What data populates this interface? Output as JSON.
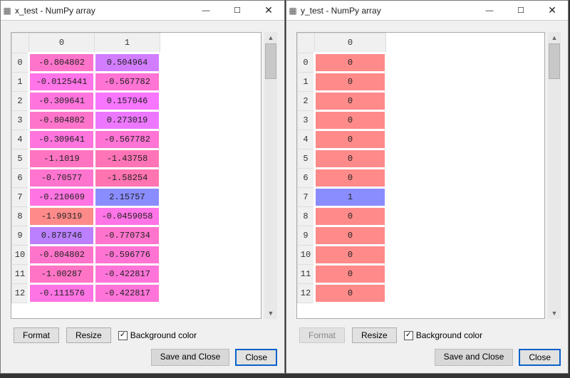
{
  "left": {
    "title": "x_test - NumPy array",
    "columns": [
      "0",
      "1"
    ],
    "rows": [
      {
        "idx": "0",
        "v": [
          "-0.804802",
          "0.504964"
        ],
        "c": [
          "#ff74cb",
          "#d27dff"
        ]
      },
      {
        "idx": "1",
        "v": [
          "-0.0125441",
          "-0.567782"
        ],
        "c": [
          "#ff74e8",
          "#ff74d4"
        ]
      },
      {
        "idx": "2",
        "v": [
          "-0.309641",
          "0.157046"
        ],
        "c": [
          "#ff74dd",
          "#f875ff"
        ]
      },
      {
        "idx": "3",
        "v": [
          "-0.804802",
          "0.273019"
        ],
        "c": [
          "#ff74cb",
          "#ed78ff"
        ]
      },
      {
        "idx": "4",
        "v": [
          "-0.309641",
          "-0.567782"
        ],
        "c": [
          "#ff74dd",
          "#ff74d4"
        ]
      },
      {
        "idx": "5",
        "v": [
          "-1.1019",
          "-1.43758"
        ],
        "c": [
          "#ff74c1",
          "#ff74b6"
        ]
      },
      {
        "idx": "6",
        "v": [
          "-0.70577",
          "-1.58254"
        ],
        "c": [
          "#ff74cf",
          "#ff74b1"
        ]
      },
      {
        "idx": "7",
        "v": [
          "-0.210609",
          "2.15757"
        ],
        "c": [
          "#ff74e1",
          "#8a8dff"
        ]
      },
      {
        "idx": "8",
        "v": [
          "-1.99319",
          "-0.0459058"
        ],
        "c": [
          "#ff8a8a",
          "#ff74e6"
        ]
      },
      {
        "idx": "9",
        "v": [
          "0.878746",
          "-0.770734"
        ],
        "c": [
          "#ba80ff",
          "#ff74cd"
        ]
      },
      {
        "idx": "10",
        "v": [
          "-0.804802",
          "-0.596776"
        ],
        "c": [
          "#ff74cb",
          "#ff74d3"
        ]
      },
      {
        "idx": "11",
        "v": [
          "-1.00287",
          "-0.422817"
        ],
        "c": [
          "#ff74c4",
          "#ff74d9"
        ]
      },
      {
        "idx": "12",
        "v": [
          "-0.111576",
          "-0.422817"
        ],
        "c": [
          "#ff74e4",
          "#ff74d9"
        ]
      }
    ]
  },
  "right": {
    "title": "y_test - NumPy array",
    "columns": [
      "0"
    ],
    "rows": [
      {
        "idx": "0",
        "v": [
          "0"
        ],
        "c": [
          "#ff8a8a"
        ]
      },
      {
        "idx": "1",
        "v": [
          "0"
        ],
        "c": [
          "#ff8a8a"
        ]
      },
      {
        "idx": "2",
        "v": [
          "0"
        ],
        "c": [
          "#ff8a8a"
        ]
      },
      {
        "idx": "3",
        "v": [
          "0"
        ],
        "c": [
          "#ff8a8a"
        ]
      },
      {
        "idx": "4",
        "v": [
          "0"
        ],
        "c": [
          "#ff8a8a"
        ]
      },
      {
        "idx": "5",
        "v": [
          "0"
        ],
        "c": [
          "#ff8a8a"
        ]
      },
      {
        "idx": "6",
        "v": [
          "0"
        ],
        "c": [
          "#ff8a8a"
        ]
      },
      {
        "idx": "7",
        "v": [
          "1"
        ],
        "c": [
          "#8a8dff"
        ]
      },
      {
        "idx": "8",
        "v": [
          "0"
        ],
        "c": [
          "#ff8a8a"
        ]
      },
      {
        "idx": "9",
        "v": [
          "0"
        ],
        "c": [
          "#ff8a8a"
        ]
      },
      {
        "idx": "10",
        "v": [
          "0"
        ],
        "c": [
          "#ff8a8a"
        ]
      },
      {
        "idx": "11",
        "v": [
          "0"
        ],
        "c": [
          "#ff8a8a"
        ]
      },
      {
        "idx": "12",
        "v": [
          "0"
        ],
        "c": [
          "#ff8a8a"
        ]
      }
    ]
  },
  "buttons": {
    "format": "Format",
    "resize": "Resize",
    "bgcolor": "Background color",
    "save_close": "Save and Close",
    "close": "Close",
    "check": "✓"
  },
  "win_controls": {
    "min": "—",
    "max": "☐",
    "close": "✕"
  }
}
